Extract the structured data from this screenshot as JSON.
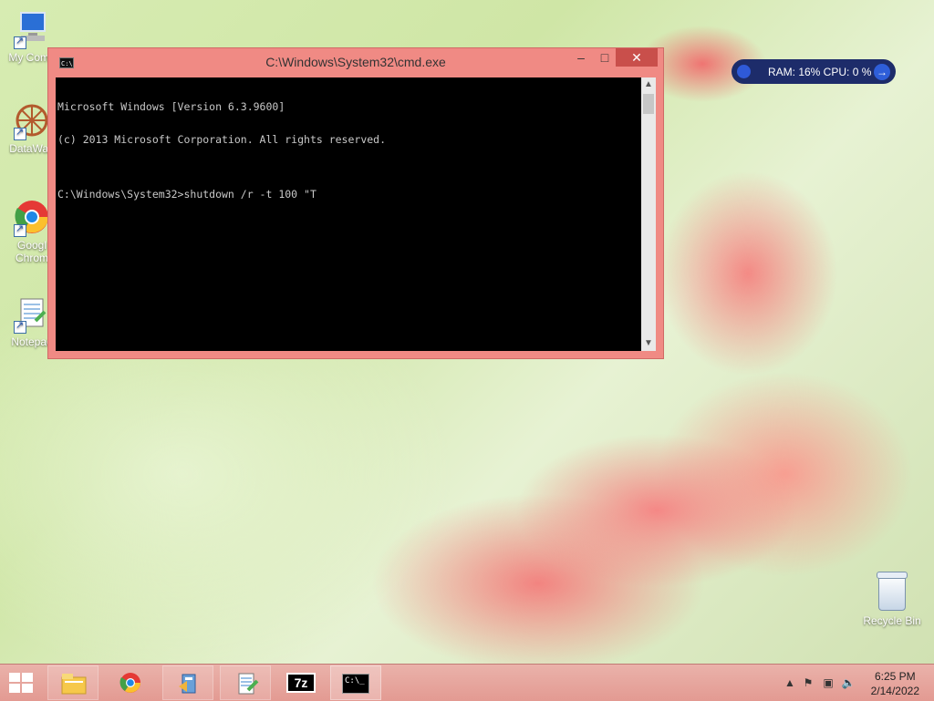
{
  "desktop": {
    "icons": [
      {
        "label": "My Comp",
        "icon": "computer-icon"
      },
      {
        "label": "DataWag",
        "icon": "datawagon-icon"
      },
      {
        "label": "Googl\nChrom",
        "icon": "chrome-icon"
      },
      {
        "label": "Notepad",
        "icon": "notepad-icon"
      }
    ],
    "recycle_bin": {
      "label": "Recycle Bin",
      "icon": "recycle-bin-icon"
    }
  },
  "window": {
    "title": "C:\\Windows\\System32\\cmd.exe",
    "console_lines": [
      "Microsoft Windows [Version 6.3.9600]",
      "(c) 2013 Microsoft Corporation. All rights reserved.",
      "",
      "C:\\Windows\\System32>shutdown /r -t 100 \"T"
    ],
    "buttons": {
      "minimize": "–",
      "maximize": "□",
      "close": "✕"
    }
  },
  "system_monitor": {
    "text": "RAM: 16%   CPU: 0 %"
  },
  "taskbar": {
    "items": [
      {
        "name": "start",
        "icon": "windows-start-icon"
      },
      {
        "name": "file-explorer",
        "icon": "file-explorer-icon"
      },
      {
        "name": "chrome",
        "icon": "chrome-icon"
      },
      {
        "name": "app-installer",
        "icon": "installer-icon"
      },
      {
        "name": "notepad-plus-plus",
        "icon": "notepadpp-icon"
      },
      {
        "name": "7zip",
        "icon": "7zip-icon",
        "label": "7z"
      },
      {
        "name": "cmd",
        "icon": "cmd-icon",
        "label": "C:\\_"
      }
    ],
    "tray": {
      "time": "6:25 PM",
      "date": "2/14/2022"
    }
  },
  "colors": {
    "window_frame": "#f08a84",
    "taskbar": "#e39a92",
    "console_bg": "#000000",
    "console_text": "#c8c8c8"
  }
}
